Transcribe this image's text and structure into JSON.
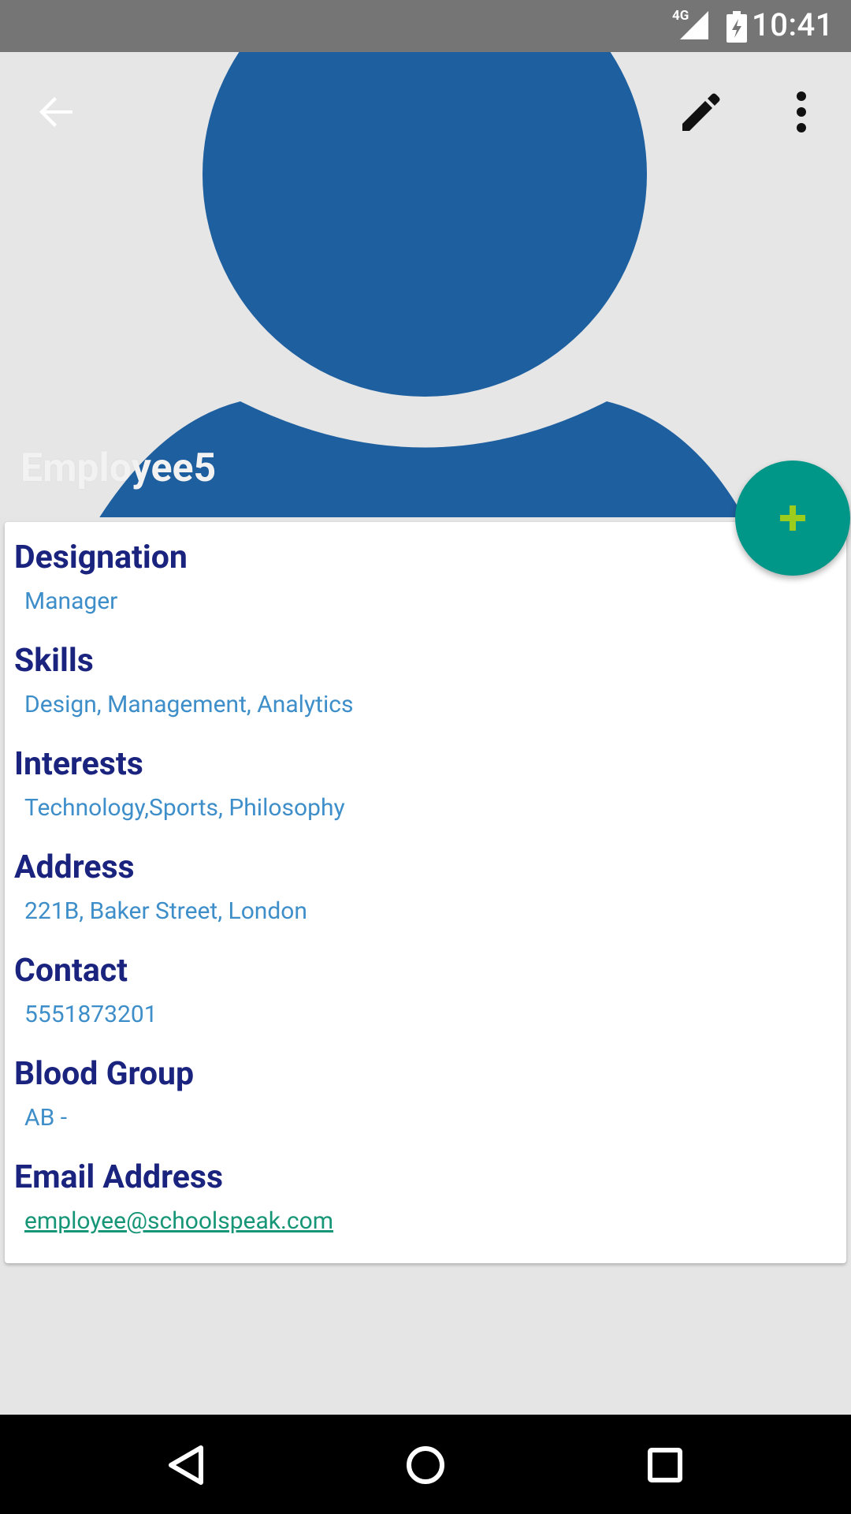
{
  "status_bar": {
    "time": "10:41",
    "network": "4G",
    "icons": [
      "signal-icon",
      "battery-icon"
    ]
  },
  "toolbar": {
    "back_icon": "arrow-back-icon",
    "edit_icon": "pencil-icon",
    "more_icon": "more-vert-icon"
  },
  "profile": {
    "name": "Employee5",
    "avatar_color": "#1e5fa0"
  },
  "details": {
    "designation_label": "Designation",
    "designation_value": "Manager",
    "skills_label": "Skills",
    "skills_value": "Design, Management, Analytics",
    "interests_label": "Interests",
    "interests_value": "Technology,Sports, Philosophy",
    "address_label": "Address",
    "address_value": "221B, Baker Street, London",
    "contact_label": "Contact",
    "contact_value": "5551873201",
    "blood_group_label": "Blood Group",
    "blood_group_value": "AB -",
    "email_label": "Email Address",
    "email_value": "employee@schoolspeak.com"
  },
  "fab": {
    "icon": "plus-icon",
    "color": "#009688",
    "icon_color": "#9ccc1c"
  },
  "nav_bar": {
    "back_icon": "nav-back-icon",
    "home_icon": "nav-home-icon",
    "recents_icon": "nav-recents-icon"
  },
  "colors": {
    "label": "#1a237e",
    "value": "#3d8ec9",
    "link": "#169677",
    "status_bar": "#757575"
  }
}
